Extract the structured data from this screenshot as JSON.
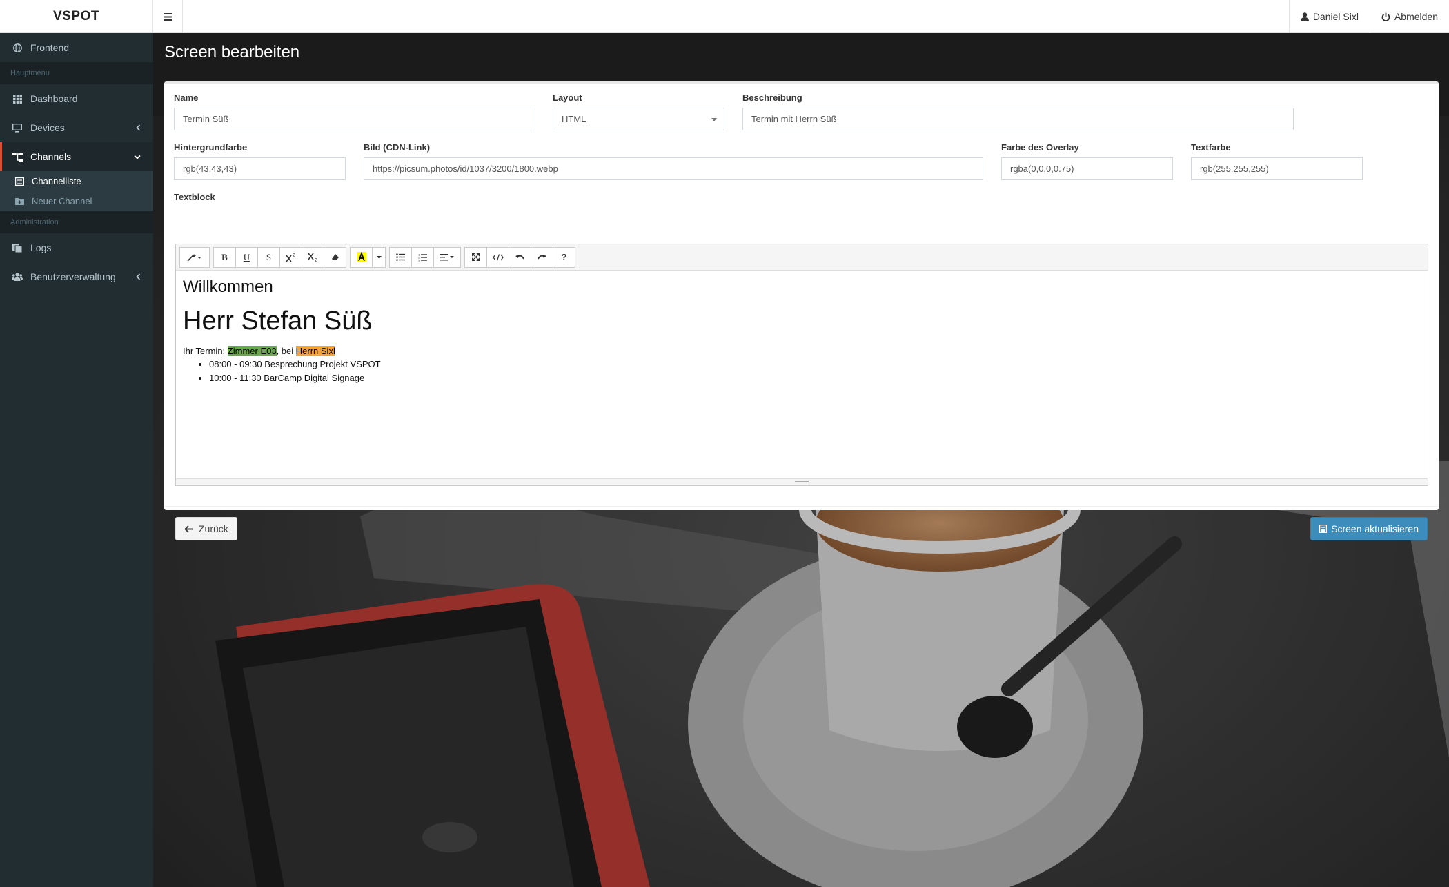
{
  "app": {
    "brand": "VSPOT"
  },
  "topnav": {
    "user": "Daniel Sixl",
    "logout": "Abmelden"
  },
  "sidebar": {
    "frontend": "Frontend",
    "header_main": "Hauptmenu",
    "dashboard": "Dashboard",
    "devices": "Devices",
    "channels": "Channels",
    "channel_list": "Channelliste",
    "new_channel": "Neuer Channel",
    "header_admin": "Administration",
    "logs": "Logs",
    "user_mgmt": "Benutzerverwaltung"
  },
  "page": {
    "title": "Screen bearbeiten"
  },
  "form": {
    "name": {
      "label": "Name",
      "value": "Termin Süß"
    },
    "layout": {
      "label": "Layout",
      "value": "HTML"
    },
    "description": {
      "label": "Beschreibung",
      "value": "Termin mit Herrn Süß"
    },
    "bgcolor": {
      "label": "Hintergrundfarbe",
      "value": "rgb(43,43,43)"
    },
    "image": {
      "label": "Bild (CDN-Link)",
      "value": "https://picsum.photos/id/1037/3200/1800.webp"
    },
    "overlay": {
      "label": "Farbe des Overlay",
      "value": "rgba(0,0,0,0.75)"
    },
    "textcolor": {
      "label": "Textfarbe",
      "value": "rgb(255,255,255)"
    },
    "textblock": {
      "label": "Textblock"
    }
  },
  "editor": {
    "heading3": "Willkommen",
    "heading1": "Herr Stefan Süß",
    "line_prefix": "Ihr Termin: ",
    "room": "Zimmer E03",
    "mid": ", bei ",
    "host": "Herrn Sixl",
    "items": [
      "08:00 - 09:30 Besprechung Projekt VSPOT",
      "10:00 - 11:30 BarCamp Digital Signage"
    ],
    "toolbar": {
      "bold": "B",
      "underline": "U",
      "strike": "S",
      "help": "?"
    }
  },
  "buttons": {
    "back": "Zurück",
    "save": "Screen aktualisieren"
  },
  "colors": {
    "sidebar": "#222d32",
    "primary": "#3c8dbc",
    "active_border": "#dd4b39",
    "highlight_green": "#6aa84f",
    "highlight_orange": "#f6a239"
  }
}
